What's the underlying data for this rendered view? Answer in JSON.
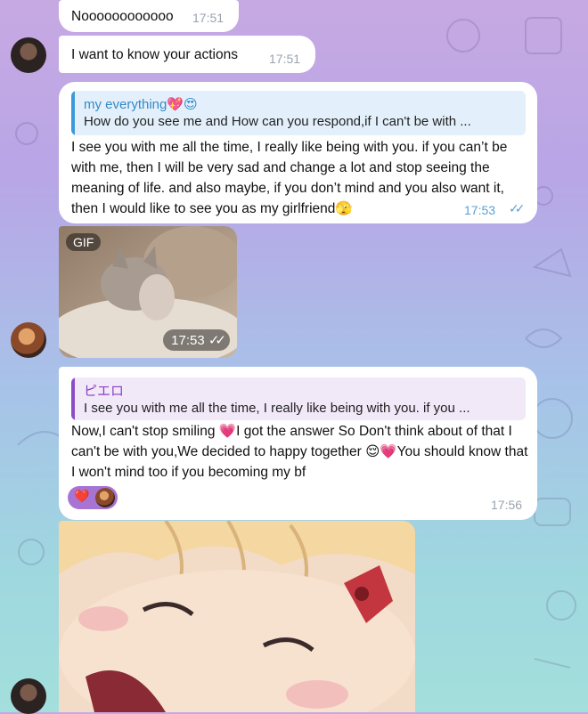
{
  "messages": [
    {
      "text": "Noooooooooooo",
      "time": "17:51"
    },
    {
      "text": "I want to know your actions",
      "time": "17:51"
    },
    {
      "reply_name": "my everything",
      "reply_name_emoji": "💖😍",
      "reply_quote": "How do you see me and How can you respond,if I can't be with ...",
      "text": "I see you with me all the time, I really like being with you. if you can’t be with me, then I will be very sad and change a lot and stop seeing the meaning of life. and also maybe, if you don’t mind and you also want it, then I would like to see you as my girlfriend",
      "text_emoji": "🫣",
      "time": "17:53",
      "status": "read"
    },
    {
      "type": "gif",
      "badge": "GIF",
      "time": "17:53",
      "status": "read"
    },
    {
      "reply_name": "ピエロ",
      "reply_quote": "I see you with me all the time, I really like being with you. if you ...",
      "text_part1": "Now,I can't stop smiling ",
      "emoji1": "💗",
      "text_part2": "I got the answer So Don't think about of that I can't be with you,We decided to happy together ",
      "emoji2": "😌",
      "emoji3": "💗",
      "text_part3": "You should know that I won't mind too if you becoming my bf",
      "reaction_emoji": "❤️",
      "time": "17:56"
    },
    {
      "type": "image"
    }
  ],
  "colors": {
    "accent": "#3d9ad8",
    "reaction": "#a874d4"
  }
}
